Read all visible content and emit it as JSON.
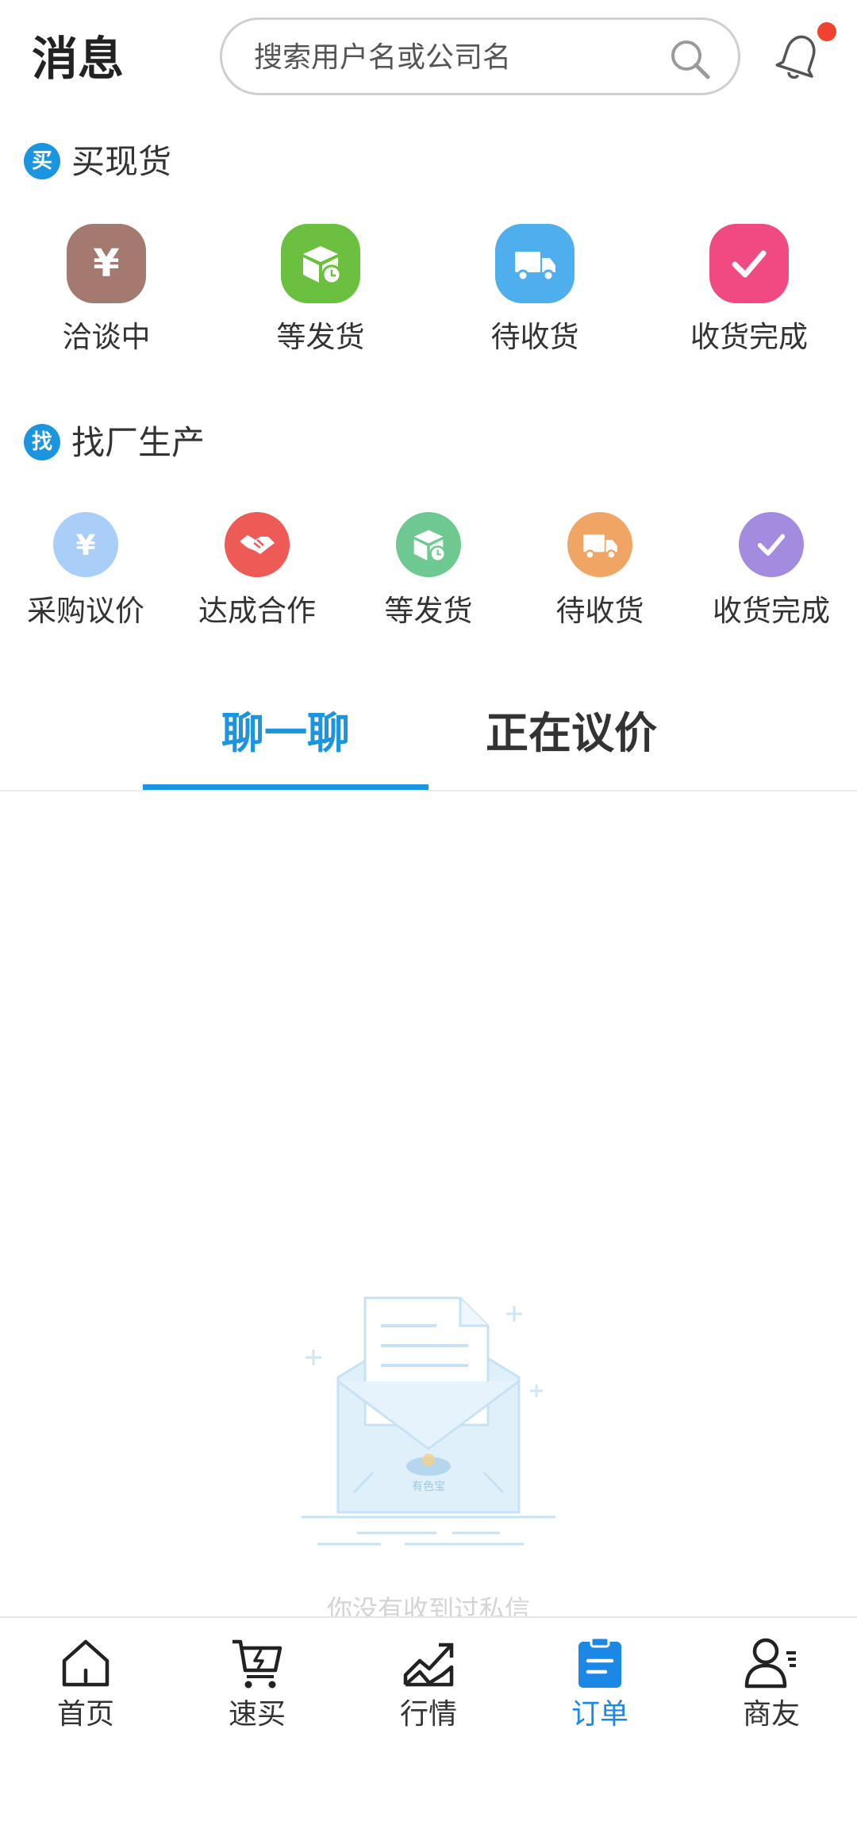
{
  "header": {
    "title": "消息",
    "search_placeholder": "搜索用户名或公司名"
  },
  "buy_section": {
    "badge": "买",
    "title": "买现货",
    "items": [
      {
        "label": "洽谈中",
        "icon": "yen-icon",
        "color": "#a47a70"
      },
      {
        "label": "等发货",
        "icon": "package-clock-icon",
        "color": "#6cc040"
      },
      {
        "label": "待收货",
        "icon": "truck-icon",
        "color": "#4eaeee"
      },
      {
        "label": "收货完成",
        "icon": "check-icon",
        "color": "#f14a82"
      }
    ]
  },
  "factory_section": {
    "badge": "找",
    "title": "找厂生产",
    "items": [
      {
        "label": "采购议价",
        "icon": "yen-icon",
        "color": "#a9cff8"
      },
      {
        "label": "达成合作",
        "icon": "handshake-icon",
        "color": "#ee5a56"
      },
      {
        "label": "等发货",
        "icon": "package-clock-icon",
        "color": "#6dc98f"
      },
      {
        "label": "待收货",
        "icon": "truck-icon",
        "color": "#f1a565"
      },
      {
        "label": "收货完成",
        "icon": "check-icon",
        "color": "#a38ce0"
      }
    ]
  },
  "tabs": [
    {
      "label": "聊一聊",
      "active": true
    },
    {
      "label": "正在议价",
      "active": false
    }
  ],
  "empty_state": {
    "logo_text": "有色宝",
    "message": "你没有收到过私信"
  },
  "bottom_nav": [
    {
      "label": "首页",
      "icon": "home-icon",
      "active": false
    },
    {
      "label": "速买",
      "icon": "quick-buy-cart-icon",
      "active": false
    },
    {
      "label": "行情",
      "icon": "market-chart-icon",
      "active": false
    },
    {
      "label": "订单",
      "icon": "order-clipboard-icon",
      "active": true
    },
    {
      "label": "商友",
      "icon": "contacts-icon",
      "active": false
    }
  ],
  "colors": {
    "accent": "#1b95e0",
    "nav_active": "#1b88e6",
    "notification_dot": "#f0432f"
  }
}
